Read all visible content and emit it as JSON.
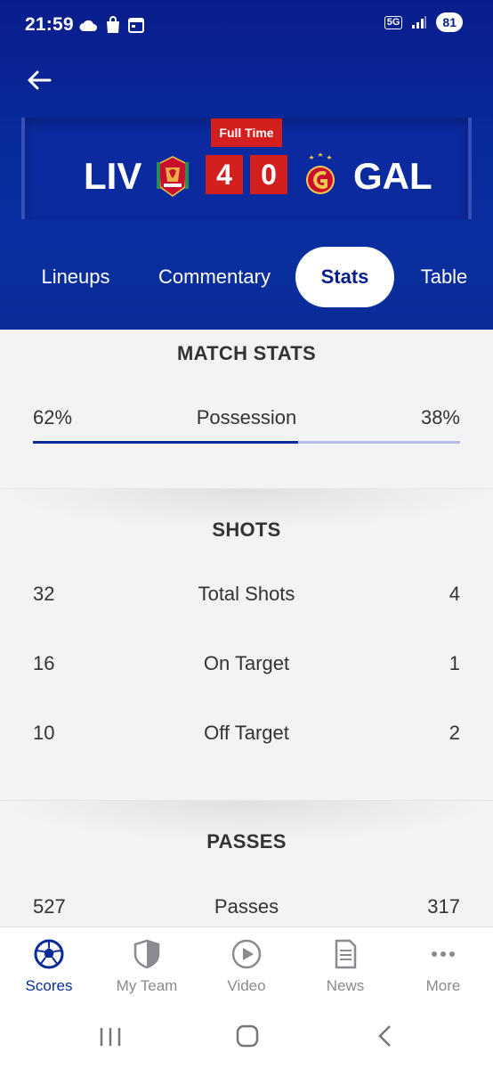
{
  "status_bar": {
    "time": "21:59",
    "network": "5G",
    "battery": "81"
  },
  "header": {
    "back_icon": "arrow-left-icon"
  },
  "match": {
    "status": "Full Time",
    "home_team": "LIV",
    "away_team": "GAL",
    "home_score": "4",
    "away_score": "0"
  },
  "tabs": [
    {
      "label": "Lineups",
      "active": false
    },
    {
      "label": "Commentary",
      "active": false
    },
    {
      "label": "Stats",
      "active": true
    },
    {
      "label": "Table",
      "active": false
    }
  ],
  "stats": {
    "match_stats_title": "MATCH STATS",
    "possession": {
      "label": "Possession",
      "home": "62%",
      "away": "38%",
      "home_fraction": 0.62
    },
    "shots_title": "SHOTS",
    "shots": [
      {
        "label": "Total Shots",
        "home": "32",
        "away": "4"
      },
      {
        "label": "On Target",
        "home": "16",
        "away": "1"
      },
      {
        "label": "Off Target",
        "home": "10",
        "away": "2"
      }
    ],
    "passes_title": "PASSES",
    "passes": [
      {
        "label": "Passes",
        "home": "527",
        "away": "317"
      }
    ]
  },
  "bottom_nav": [
    {
      "label": "Scores",
      "icon": "football-icon",
      "active": true
    },
    {
      "label": "My Team",
      "icon": "shield-icon",
      "active": false
    },
    {
      "label": "Video",
      "icon": "play-icon",
      "active": false
    },
    {
      "label": "News",
      "icon": "document-icon",
      "active": false
    },
    {
      "label": "More",
      "icon": "more-dots-icon",
      "active": false
    }
  ],
  "colors": {
    "brand_blue": "#0a2c98",
    "score_red": "#d41f1f"
  }
}
